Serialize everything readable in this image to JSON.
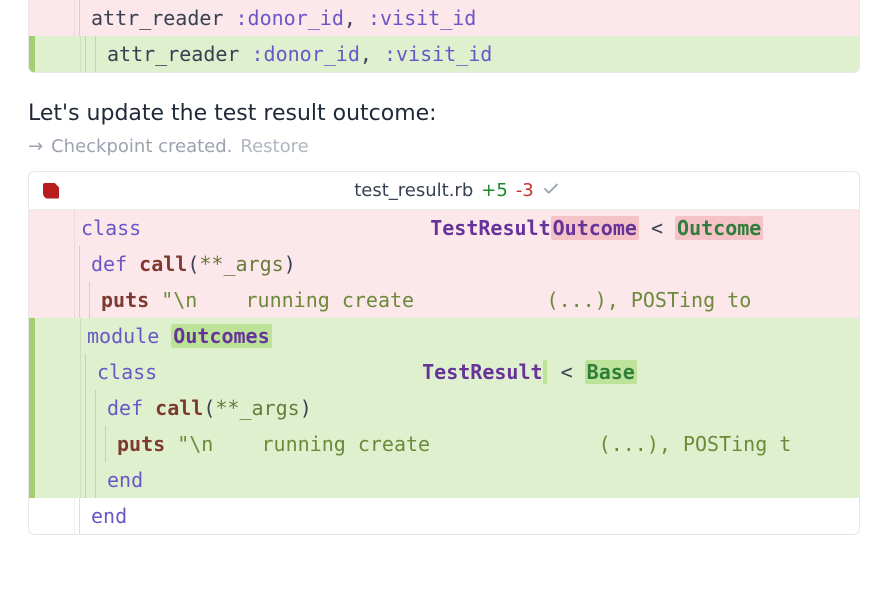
{
  "block1": {
    "rows": [
      {
        "kind": "minus",
        "indent": 1,
        "tokens": [
          {
            "t": "attr_reader ",
            "c": "dim"
          },
          {
            "t": ":donor_id",
            "c": "sym"
          },
          {
            "t": ", ",
            "c": "dim"
          },
          {
            "t": ":visit_id",
            "c": "sym"
          }
        ]
      },
      {
        "kind": "plus",
        "indent": 2,
        "tokens": [
          {
            "t": "attr_reader ",
            "c": "dim"
          },
          {
            "t": ":donor_id",
            "c": "sym"
          },
          {
            "t": ", ",
            "c": "dim"
          },
          {
            "t": ":visit_id",
            "c": "sym"
          }
        ]
      }
    ]
  },
  "message": "Let's update the test result outcome:",
  "checkpoint": {
    "arrow": "→",
    "text": "Checkpoint created.",
    "restore": "Restore"
  },
  "block2": {
    "filename": "test_result.rb",
    "additions": "+5",
    "deletions": "-3",
    "rows": [
      {
        "kind": "minus",
        "indent": 0,
        "tokens": [
          {
            "t": "class",
            "c": "kw"
          },
          {
            "t": "                        ",
            "c": ""
          },
          {
            "t": "TestResult",
            "c": "type"
          },
          {
            "t": "Outcome",
            "c": "type",
            "hl": "del"
          },
          {
            "t": " < ",
            "c": "dim"
          },
          {
            "t": "Outcome",
            "c": "typeG",
            "hl": "del"
          }
        ]
      },
      {
        "kind": "minus",
        "indent": 1,
        "tokens": [
          {
            "t": "def ",
            "c": "kw"
          },
          {
            "t": "call",
            "c": "fn"
          },
          {
            "t": "(",
            "c": "dim"
          },
          {
            "t": "**_args",
            "c": "sym2"
          },
          {
            "t": ")",
            "c": "dim"
          }
        ]
      },
      {
        "kind": "minus",
        "indent": 2,
        "tokens": [
          {
            "t": "puts ",
            "c": "fn"
          },
          {
            "t": "\"\\n",
            "c": "str"
          },
          {
            "t": "    running create",
            "c": "str"
          },
          {
            "t": "           ",
            "c": ""
          },
          {
            "t": "(...), POSTing to ",
            "c": "str"
          }
        ]
      },
      {
        "kind": "plus",
        "indent": 0,
        "tokens": [
          {
            "t": "module ",
            "c": "kw"
          },
          {
            "t": "Outcomes",
            "c": "type",
            "hl": "add"
          }
        ]
      },
      {
        "kind": "plus",
        "indent": 1,
        "tokens": [
          {
            "t": "class",
            "c": "kw"
          },
          {
            "t": "                      ",
            "c": ""
          },
          {
            "t": "TestResult",
            "c": "type"
          },
          {
            "t": " < ",
            "c": "dim",
            "hl": "add-sp"
          },
          {
            "t": "Base",
            "c": "typeG",
            "hl": "add"
          }
        ]
      },
      {
        "kind": "plus",
        "indent": 2,
        "tokens": [
          {
            "t": "def ",
            "c": "kw"
          },
          {
            "t": "call",
            "c": "fn"
          },
          {
            "t": "(",
            "c": "dim"
          },
          {
            "t": "**_args",
            "c": "sym2"
          },
          {
            "t": ")",
            "c": "dim"
          }
        ]
      },
      {
        "kind": "plus",
        "indent": 3,
        "tokens": [
          {
            "t": "puts ",
            "c": "fn"
          },
          {
            "t": "\"\\n",
            "c": "str"
          },
          {
            "t": "    running create",
            "c": "str"
          },
          {
            "t": "              ",
            "c": ""
          },
          {
            "t": "(...), POSTing t",
            "c": "str"
          }
        ]
      },
      {
        "kind": "plus",
        "indent": 2,
        "tokens": [
          {
            "t": "end",
            "c": "kw"
          }
        ]
      },
      {
        "kind": "plain",
        "indent": 1,
        "tokens": [
          {
            "t": "end",
            "c": "kw"
          }
        ]
      }
    ]
  }
}
